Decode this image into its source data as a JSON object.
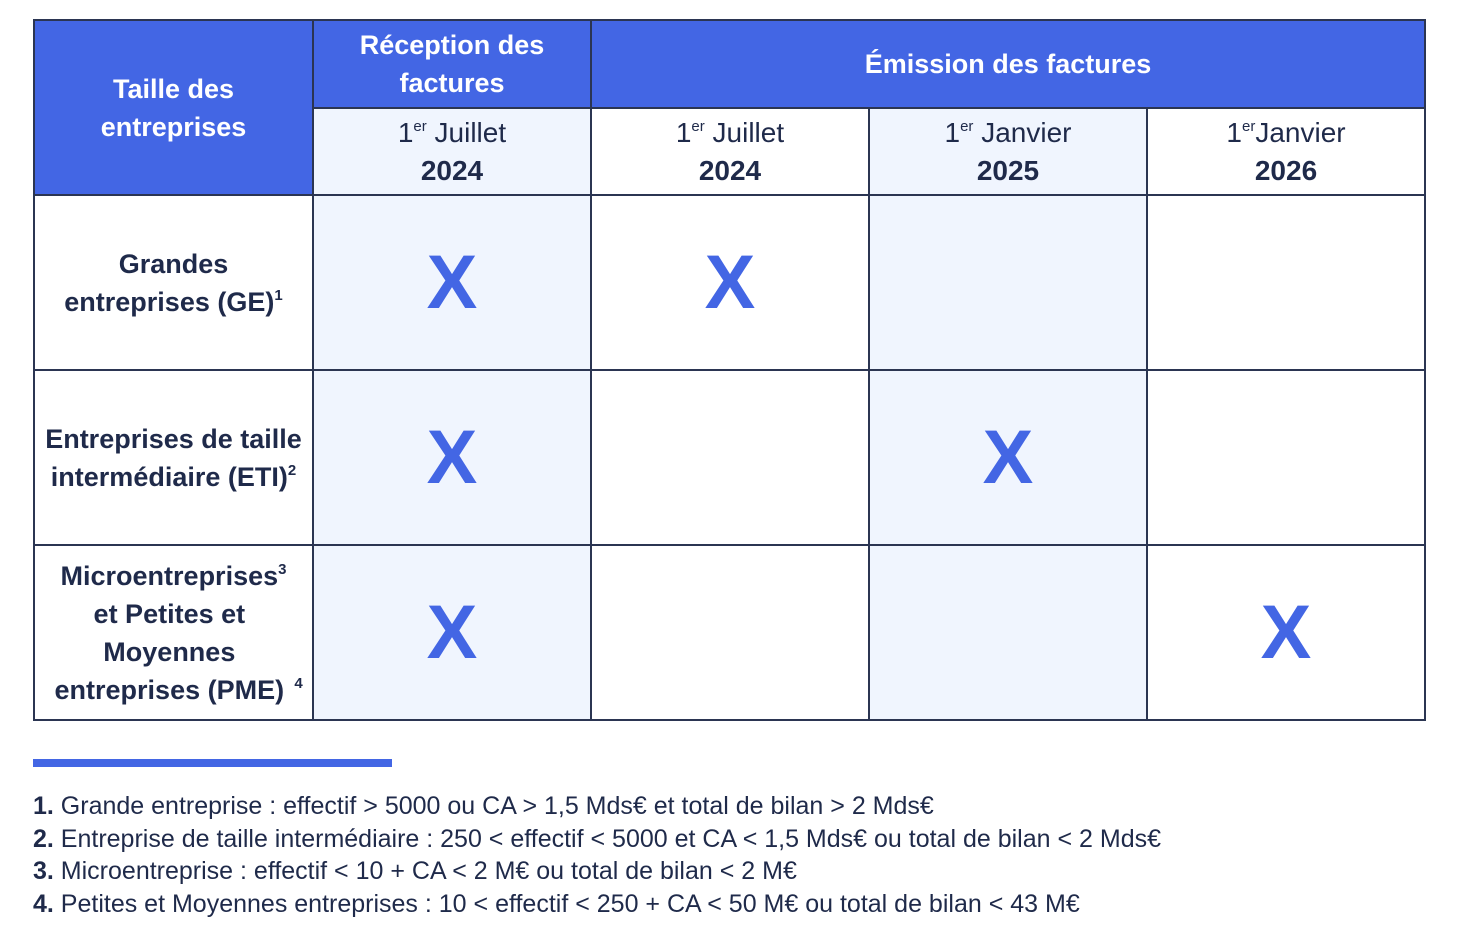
{
  "table": {
    "corner_header": "Taille des entreprises",
    "group_headers": [
      {
        "label": "Réception des factures",
        "span": 1
      },
      {
        "label": "Émission des factures",
        "span": 3
      }
    ],
    "columns": [
      {
        "day": "1",
        "sup": "er",
        "month": "Juillet",
        "year": "2024",
        "group": "Réception des factures"
      },
      {
        "day": "1",
        "sup": "er",
        "month": "Juillet",
        "year": "2024",
        "group": "Émission des factures"
      },
      {
        "day": "1",
        "sup": "er",
        "month": "Janvier",
        "year": "2025",
        "group": "Émission des factures"
      },
      {
        "day": "1",
        "sup": "er",
        "month": "Janvier",
        "year": "2026",
        "group": "Émission des factures"
      }
    ],
    "rows": [
      {
        "label": "Grandes entreprises (GE)",
        "footnote": "1",
        "cells": [
          "X",
          "X",
          "",
          ""
        ]
      },
      {
        "label": "Entreprises de taille intermédiaire (ETI)",
        "footnote": "2",
        "cells": [
          "X",
          "",
          "X",
          ""
        ]
      },
      {
        "label_part1": "Microentreprises",
        "footnote_a": "3",
        "label_part2": "et Petites et Moyennes entreprises (PME)",
        "footnote": "4",
        "cells": [
          "X",
          "",
          "",
          "X"
        ]
      }
    ]
  },
  "footnotes": [
    {
      "num": "1.",
      "text": " Grande entreprise : effectif > 5000 ou CA > 1,5 Mds€ et total de bilan > 2 Mds€"
    },
    {
      "num": "2.",
      "text": " Entreprise de taille intermédiaire : 250 < effectif < 5000 et CA < 1,5 Mds€ ou total de bilan < 2 Mds€"
    },
    {
      "num": "3.",
      "text": " Microentreprise : effectif < 10 + CA < 2 M€ ou total de bilan < 2 M€"
    },
    {
      "num": "4.",
      "text": " Petites et Moyennes entreprises : 10 < effectif < 250 + CA < 50 M€ ou total de bilan < 43 M€"
    }
  ],
  "colors": {
    "accent": "#4366e4",
    "text": "#1f2a4a",
    "shade": "#f0f5fe",
    "border": "#2b3552"
  }
}
